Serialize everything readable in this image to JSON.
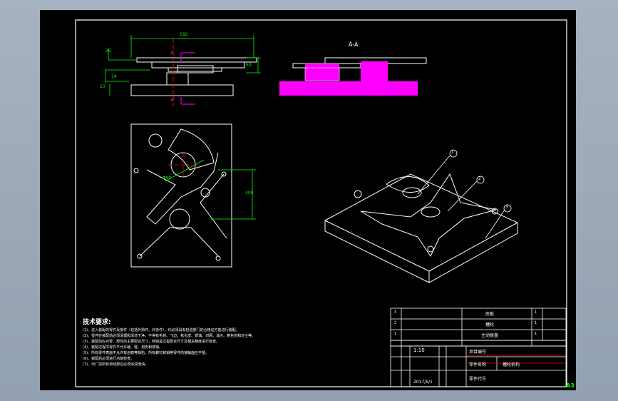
{
  "section_label": "A-A",
  "section_marker_top": "A",
  "section_marker_bottom": "A",
  "dimensions": {
    "top_width": "192",
    "left_top": "25",
    "left_mid": "34",
    "left_low": "10",
    "right_height": "50",
    "plan_height": "400",
    "plan_diameter": "Φ90"
  },
  "balloons": [
    "1",
    "2",
    "3"
  ],
  "tech": {
    "title": "技术要求:",
    "lines": [
      "(1)、进入装配的零件及部件（包括外购件、外协件），均必须具有检验部门的合格证方能进行装配。",
      "(2)、零件在装配前必须清理和清洗干净，不得有毛刺、飞边、氧化皮、锈蚀、切屑、油污、着色剂和灰尘等。",
      "(3)、装配前应对零、部件的主要配合尺寸，特别是过盈配合尺寸及相关精度进行复查。",
      "(4)、装配过程中零件不允许磕、碰、划伤和锈蚀。",
      "(5)、所有零件表面不允许有划痕等缺陷，所有螺钉和销等零件的接触面应平整。",
      "(6)、装配后必须进行功能检查。",
      "(7)、出厂前所有滑动部位必须涂润滑油。"
    ]
  },
  "bom": [
    {
      "no": "3",
      "name": "底板",
      "qty": "1"
    },
    {
      "no": "2",
      "name": "槽轮",
      "qty": "1"
    },
    {
      "no": "1",
      "name": "主动拨盘",
      "qty": "1"
    }
  ],
  "title_block": {
    "scale": "1:10",
    "date": "2017/5/1",
    "label_project": "项目编号",
    "label_name": "零件名称",
    "name_value": "槽轮机构",
    "label_code": "零件代号",
    "sheet_size": "A3"
  },
  "colors": {
    "line": "#ffffff",
    "dim": "#00ff00",
    "section": "#ff00ff",
    "red": "#ff0000",
    "frame": "#ffffff"
  }
}
